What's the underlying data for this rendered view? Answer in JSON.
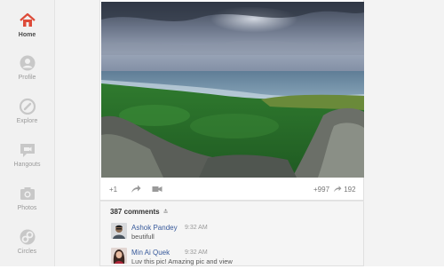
{
  "nav": {
    "items": [
      {
        "label": "Home",
        "icon": "home-icon",
        "active": true
      },
      {
        "label": "Profile",
        "icon": "profile-icon",
        "active": false
      },
      {
        "label": "Explore",
        "icon": "explore-icon",
        "active": false
      },
      {
        "label": "Hangouts",
        "icon": "hangouts-icon",
        "active": false
      },
      {
        "label": "Photos",
        "icon": "photos-icon",
        "active": false
      },
      {
        "label": "Circles",
        "icon": "circles-icon",
        "active": false
      }
    ],
    "accent": "#dd4b39"
  },
  "post": {
    "plus_one_label": "+1",
    "plus_count": "+997",
    "share_count": "192"
  },
  "comments": {
    "header": "387 comments",
    "items": [
      {
        "author": "Ashok Pandey",
        "time": "9:32 AM",
        "text": "beutifull"
      },
      {
        "author": "Min Ai Quek",
        "time": "9:32 AM",
        "text": "Luv this pic! Amazing pic and view"
      }
    ]
  }
}
